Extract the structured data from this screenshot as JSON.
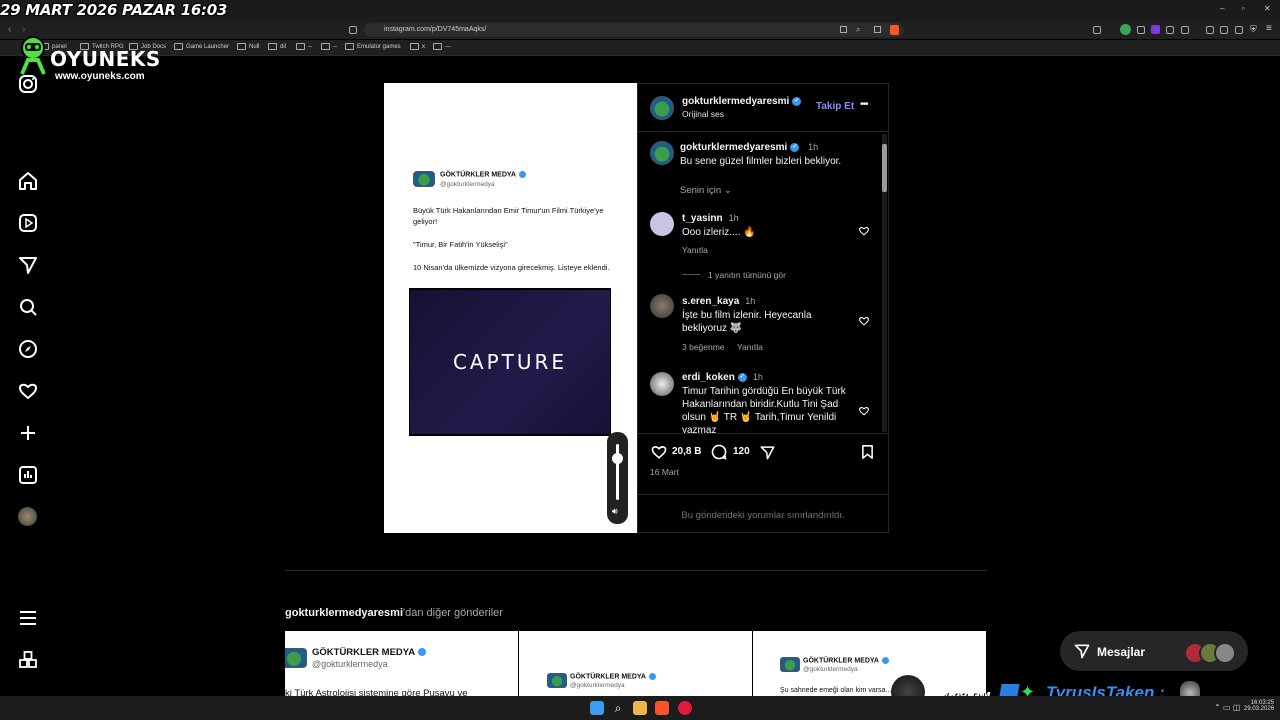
{
  "overlay": {
    "stream_date": "29 MART 2026 PAZAR 16:03",
    "logo_name": "OYUNEKS",
    "logo_url": "www.oyuneks.com",
    "stream_time": "4:03 PM",
    "streamer_name": "TyrusIsTaken :"
  },
  "browser": {
    "url": "instagram.com/p/DV745maAqks/",
    "bookmarks": [
      "panel",
      "Twitch RPG",
      "Job Docs",
      "Game Launcher",
      "Null",
      "dil",
      "--",
      "--",
      "Emulator games",
      "x",
      "---"
    ],
    "window_controls": [
      "–",
      "▫",
      "✕"
    ]
  },
  "sidebar": {
    "items": [
      "instagram-icon",
      "home-icon",
      "reels-icon",
      "messages-icon",
      "search-icon",
      "explore-icon",
      "notifications-icon",
      "create-icon",
      "dashboard-icon",
      "profile-avatar",
      "menu-icon",
      "apps-icon"
    ]
  },
  "post": {
    "username": "gokturklermedyaresmi",
    "audio": "Orijinal ses",
    "follow_label": "Takip Et",
    "more_label": "•••",
    "tweet": {
      "name": "GÖKTÜRKLER MEDYA",
      "handle": "@gokturklermedya",
      "line1": "Büyük Türk Hakanlarından Emir Timur'un Filmi Türkiye'ye geliyor!",
      "line2": "\"Timur, Bir Fatih'in Yükselişi\"",
      "line3": "10 Nisan'da ülkemizde vizyona girecekmiş. Listeye eklendi."
    },
    "video_brand": "CAPTURE",
    "caption": {
      "username": "gokturklermedyaresmi",
      "time": "1h",
      "text": "Bu sene güzel filmler bizleri bekliyor."
    },
    "for_you_label": "Senin için",
    "comments": [
      {
        "username": "t_yasinn",
        "time": "1h",
        "text": "Ooo izleriz.... 🔥",
        "reply_label": "Yanıtla",
        "view_replies": "1 yanıtın tümünü gör"
      },
      {
        "username": "s.eren_kaya",
        "time": "1h",
        "text": "İşte bu film izlenir. Heyecanla bekliyoruz 🐺",
        "likes": "3 beğenme",
        "reply_label": "Yanıtla"
      },
      {
        "username": "erdi_koken",
        "time": "1h",
        "text": "Timur Tarihin gördüğü En büyük Türk Hakanlarından biridir.Kutlu Tini Şad olsun 🤘 TR 🤘 Tarih,Timur Yenildi yazmaz"
      }
    ],
    "likes": "20,8 B",
    "comment_count": "120",
    "date": "16 Mart",
    "comments_restricted": "Bu gönderideki yorumlar sınırlandırıldı."
  },
  "more_posts": {
    "username": "gokturklermedyaresmi",
    "suffix": "'dan diğer gönderiler",
    "thumbs": [
      {
        "name": "GÖKTÜRKLER MEDYA",
        "handle": "@gokturklermedya",
        "text": "ki Türk Astrolojisi sistemine göre Pusavu ve"
      },
      {
        "name": "GÖKTÜRKLER MEDYA",
        "handle": "@gokturklermedya",
        "text": ""
      },
      {
        "name": "GÖKTÜRKLER MEDYA",
        "handle": "@gokturklermedya",
        "text": "Şu sahnede emeği olan kim varsa... öperiz"
      }
    ]
  },
  "messages": {
    "label": "Mesajlar"
  },
  "taskbar": {
    "clock_time": "16:03:25",
    "clock_date": "29.03.2026"
  }
}
